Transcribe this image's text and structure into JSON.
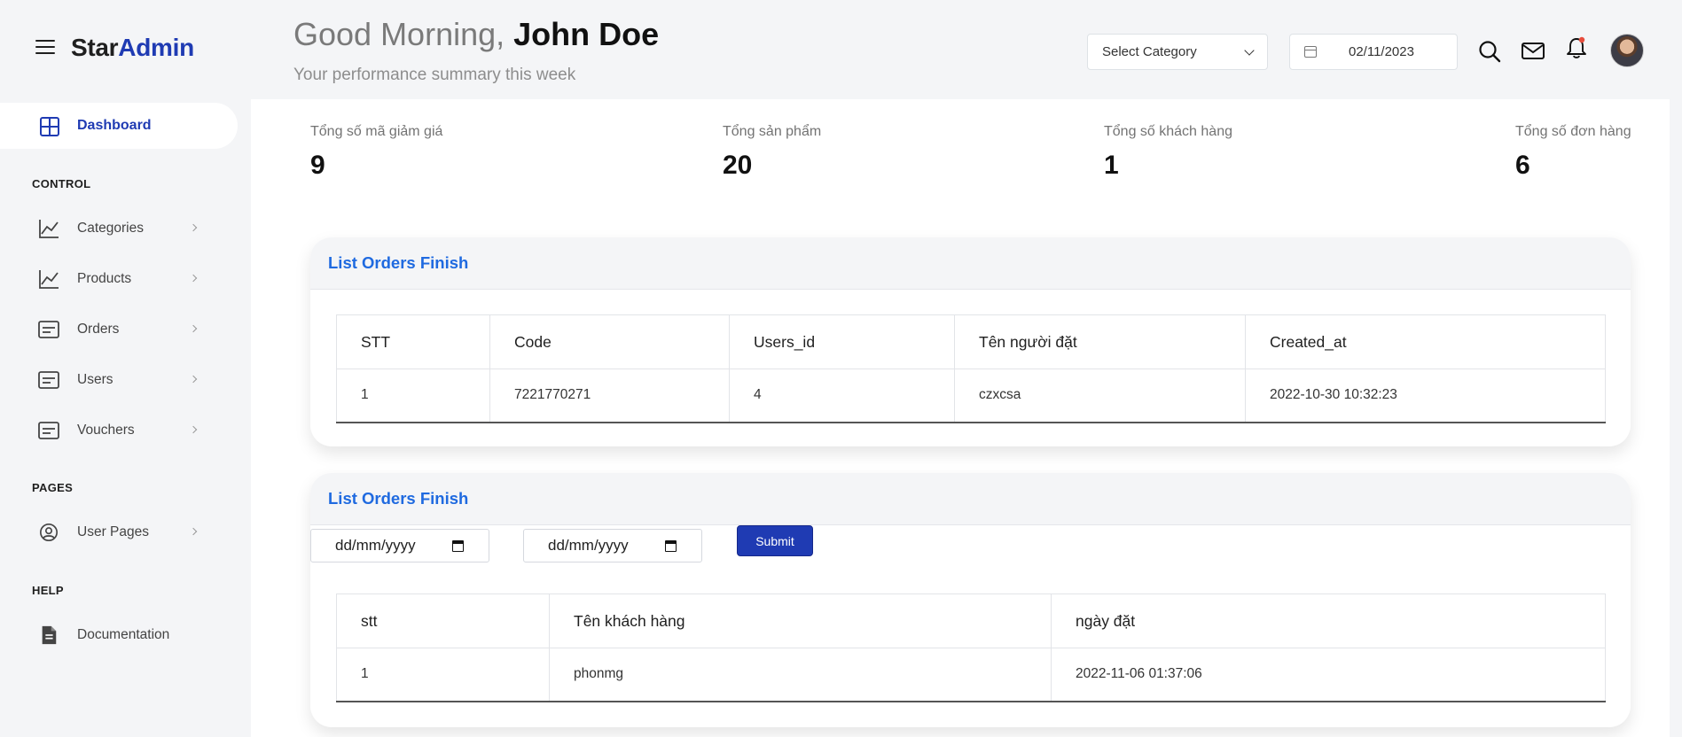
{
  "brand": {
    "part1": "Star",
    "part2": "Admin"
  },
  "header": {
    "greeting_prefix": "Good Morning, ",
    "user_name": "John Doe",
    "subtitle": "Your performance summary this week",
    "category_select": "Select Category",
    "date": "02/11/2023"
  },
  "sidebar": {
    "dashboard": "Dashboard",
    "control_title": "CONTROL",
    "items": [
      {
        "label": "Categories",
        "icon": "chart-line-icon"
      },
      {
        "label": "Products",
        "icon": "chart-line-icon"
      },
      {
        "label": "Orders",
        "icon": "card-icon"
      },
      {
        "label": "Users",
        "icon": "card-icon"
      },
      {
        "label": "Vouchers",
        "icon": "card-icon"
      }
    ],
    "pages_title": "PAGES",
    "user_pages": "User Pages",
    "help_title": "HELP",
    "documentation": "Documentation"
  },
  "stats": [
    {
      "title": "Tổng số mã giảm giá",
      "value": "9"
    },
    {
      "title": "Tổng sản phẩm",
      "value": "20"
    },
    {
      "title": "Tổng số khách hàng",
      "value": "1"
    },
    {
      "title": "Tổng số đơn hàng",
      "value": "6"
    }
  ],
  "card1": {
    "title": "List Orders Finish",
    "columns": [
      "STT",
      "Code",
      "Users_id",
      "Tên người đặt",
      "Created_at"
    ],
    "rows": [
      [
        "1",
        "7221770271",
        "4",
        "czxcsa",
        "2022-10-30 10:32:23"
      ]
    ]
  },
  "card2": {
    "title": "List Orders Finish",
    "date_from_placeholder": "dd/mm/yyyy",
    "date_to_placeholder": "dd/mm/yyyy",
    "submit_label": "Submit",
    "columns": [
      "stt",
      "Tên khách hàng",
      "ngày đặt"
    ],
    "rows": [
      [
        "1",
        "phonmg",
        "2022-11-06 01:37:06"
      ]
    ]
  },
  "colors": {
    "brand_blue": "#1f3bb3",
    "link_blue": "#1f6ae0",
    "notification_dot": "#e74c3c"
  }
}
